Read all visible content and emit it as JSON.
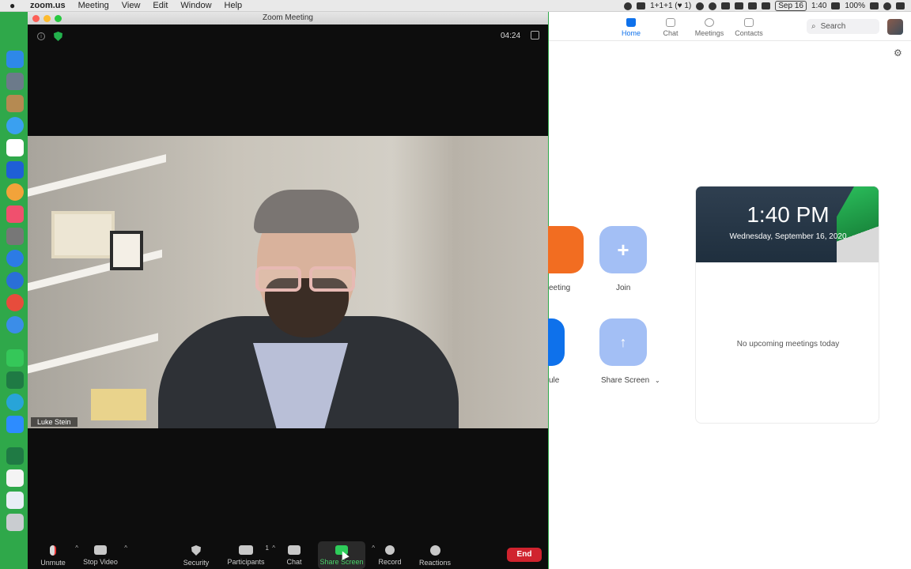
{
  "menubar": {
    "app_name": "zoom.us",
    "menus": [
      "Meeting",
      "View",
      "Edit",
      "Window",
      "Help"
    ],
    "status_text": "1+1+1 (♥ 1)",
    "date": "Sep 16",
    "time": "1:40",
    "battery": "100%"
  },
  "meeting_window": {
    "title": "Zoom Meeting",
    "timer": "04:24",
    "participant_name": "Luke Stein"
  },
  "toolbar": {
    "unmute": "Unmute",
    "stop_video": "Stop Video",
    "security": "Security",
    "participants": "Participants",
    "participants_count": "1",
    "chat": "Chat",
    "share_screen": "Share Screen",
    "record": "Record",
    "reactions": "Reactions",
    "end": "End"
  },
  "home_window": {
    "nav": [
      "Home",
      "Chat",
      "Meetings",
      "Contacts"
    ],
    "search_placeholder": "Search",
    "actions": {
      "new_meeting_partial": "eeting",
      "join": "Join",
      "schedule_partial": "ule",
      "share_screen": "Share Screen"
    },
    "clock_time": "1:40 PM",
    "clock_date": "Wednesday, September 16, 2020",
    "no_meetings": "No upcoming meetings today"
  },
  "colors": {
    "zoom_blue": "#0e71eb",
    "end_red": "#d0232e",
    "share_green": "#2ecc5a",
    "new_meeting_orange": "#f26d21",
    "light_action_blue": "#a3bff5"
  }
}
